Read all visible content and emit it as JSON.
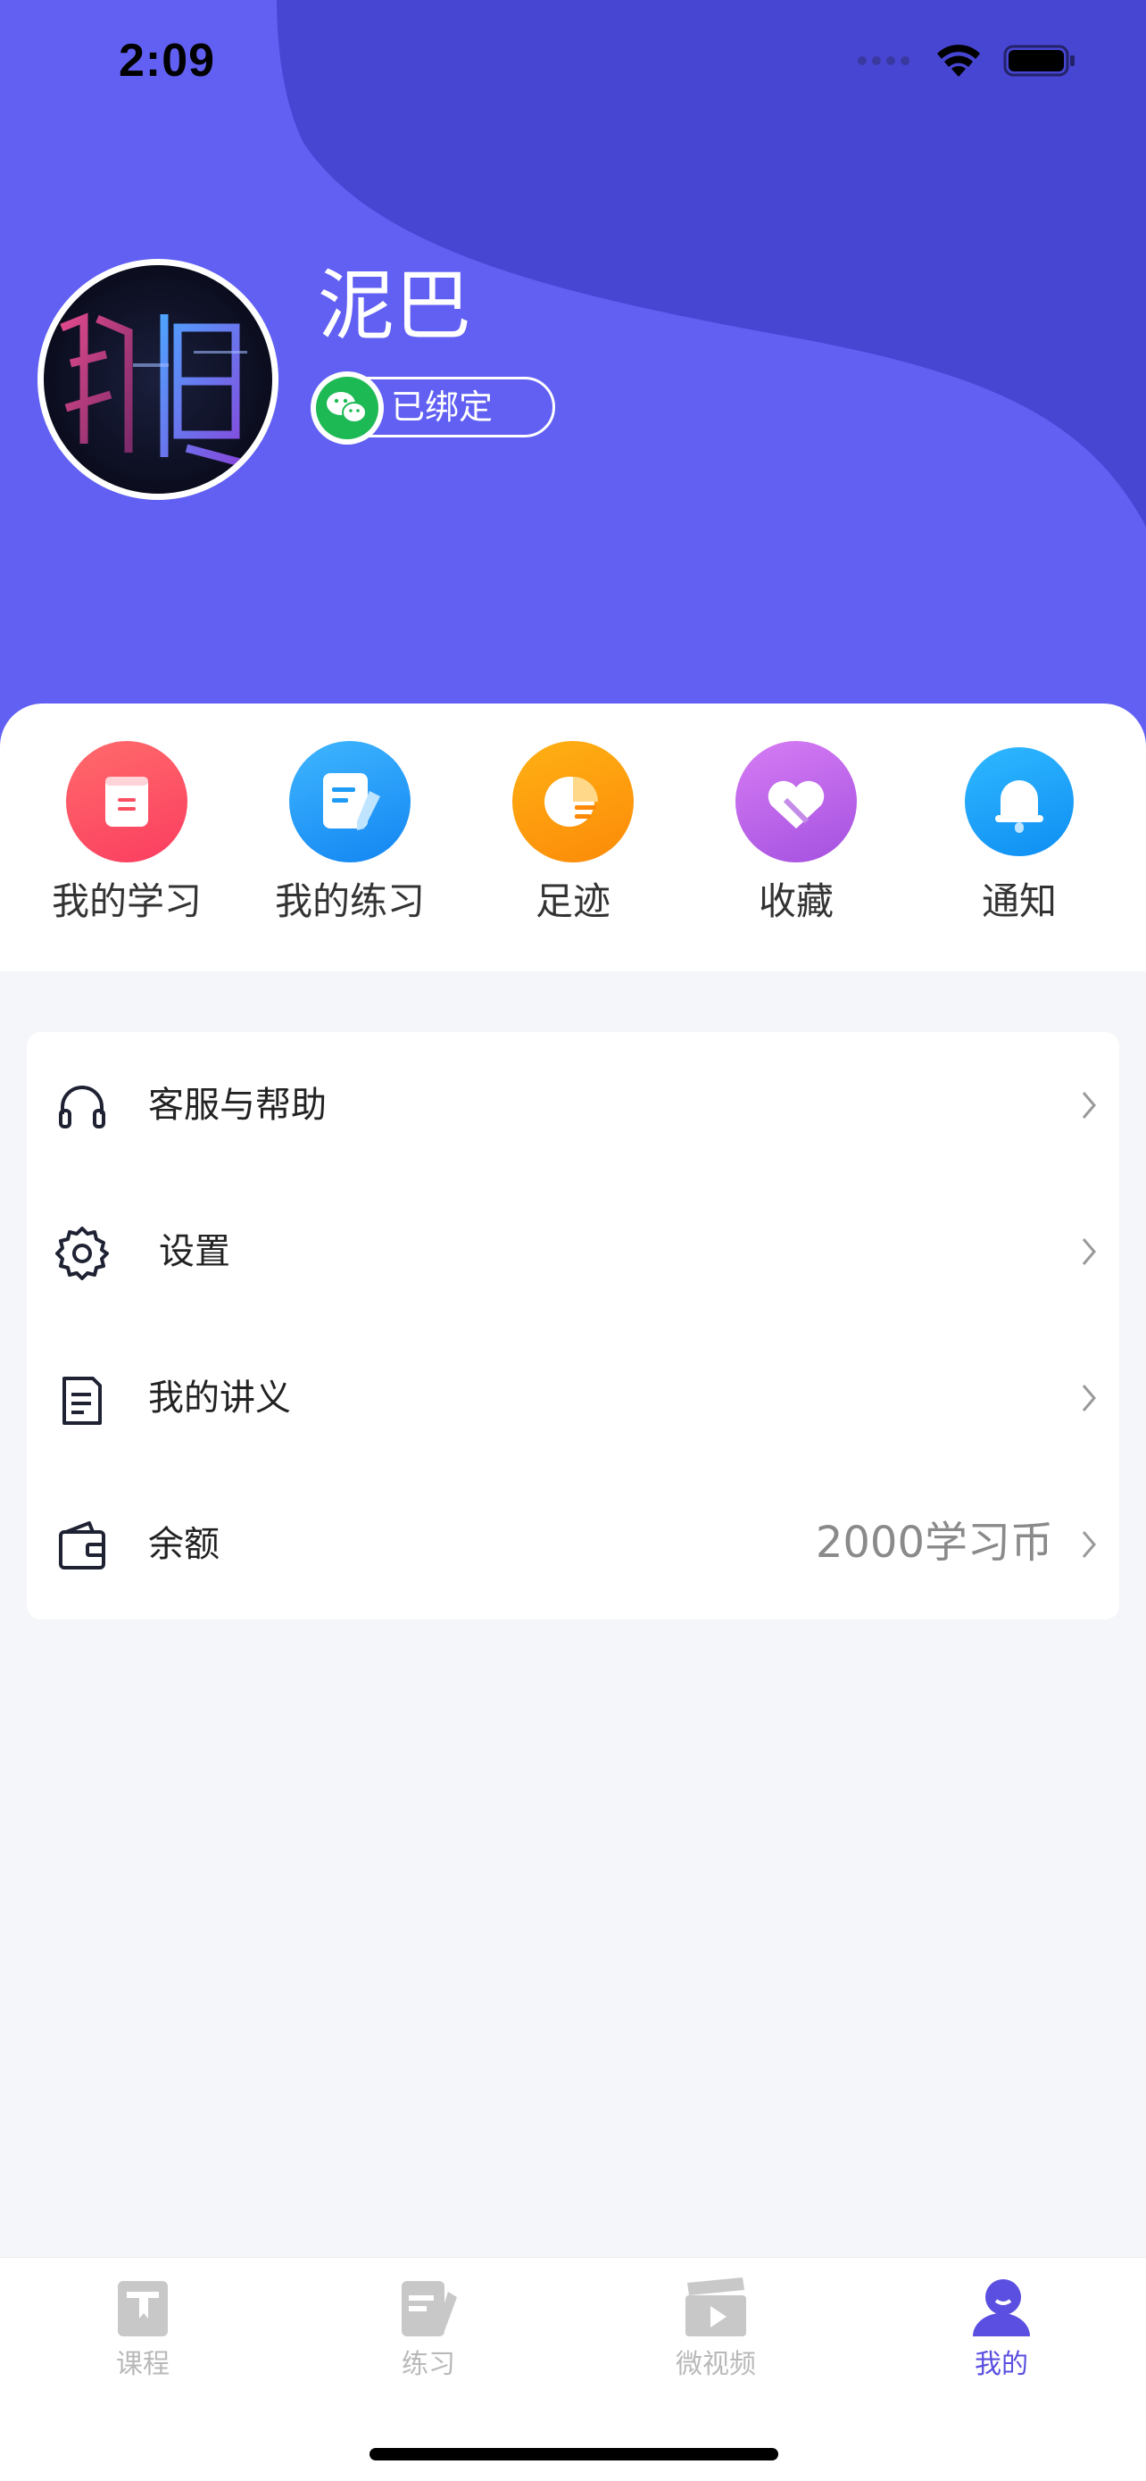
{
  "status_bar": {
    "time": "2:09"
  },
  "profile": {
    "name": "泥巴",
    "bind_status": "已绑定"
  },
  "quick_actions": [
    {
      "label": "我的学习",
      "color": "#fb4f62",
      "icon": "notebook-icon"
    },
    {
      "label": "我的练习",
      "color": "#1e9bf7",
      "icon": "exercise-pen-icon"
    },
    {
      "label": "足迹",
      "color": "#fd9a0e",
      "icon": "pie-chart-icon"
    },
    {
      "label": "收藏",
      "color": "#b763ea",
      "icon": "heart-icon"
    },
    {
      "label": "通知",
      "color": "#1a9cf6",
      "icon": "bell-icon"
    }
  ],
  "menu": [
    {
      "label": "客服与帮助",
      "icon": "headset-icon",
      "value": ""
    },
    {
      "label": "设置",
      "icon": "gear-icon",
      "value": ""
    },
    {
      "label": "我的讲义",
      "icon": "document-icon",
      "value": ""
    },
    {
      "label": "余额",
      "icon": "wallet-icon",
      "value": "2000学习币"
    }
  ],
  "tabs": [
    {
      "label": "课程",
      "icon": "course-icon",
      "active": false
    },
    {
      "label": "练习",
      "icon": "practice-icon",
      "active": false
    },
    {
      "label": "微视频",
      "icon": "video-icon",
      "active": false
    },
    {
      "label": "我的",
      "icon": "profile-icon",
      "active": true
    }
  ],
  "colors": {
    "header": "#6160f3",
    "header_wave": "#4746d3",
    "active_tab": "#5a4fe0"
  }
}
